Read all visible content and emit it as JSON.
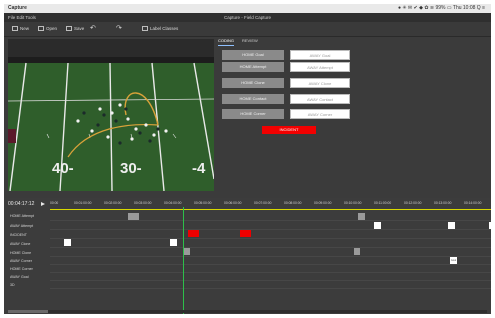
{
  "menubar": {
    "app": "Capture",
    "status": "● ✳ ✉ ✔ ◆ ✿ ≋ 99% ▭  Thu 10:08  Q  ≡"
  },
  "window": {
    "menu": "File  Edit  Tools",
    "title": "Capture - Field Capture"
  },
  "toolbar": {
    "new": "New",
    "open": "Open",
    "save": "Save",
    "label_classes": "Label Classes"
  },
  "video": {
    "yard_left": "40-",
    "yard_mid": "30-",
    "yard_right": "-4"
  },
  "tabs": [
    {
      "label": "CODING"
    },
    {
      "label": "REVIEW"
    }
  ],
  "coding": {
    "buttons": [
      "HOME Goal",
      "HOME Attempt",
      "HOME Clone",
      "HOME Contact",
      "HOME Corner"
    ],
    "inputs": [
      "AWAY Goal",
      "AWAY Attempt",
      "AWAY Clone",
      "AWAY Contact",
      "AWAY Corner"
    ],
    "incident": "INCIDENT"
  },
  "timeline": {
    "current_time": "00:04:17:12",
    "ticks": [
      "00:00",
      "00:01:00:00",
      "00:02:00:00",
      "00:03:00:00",
      "00:04:00:00",
      "00:05:00:00",
      "00:06:00:00",
      "00:07:00:00",
      "00:08:00:00",
      "00:09:00:00",
      "00:10:00:00",
      "00:11:00:00",
      "00:12:00:00",
      "00:13:00:00",
      "00:14:00:00"
    ],
    "rows": [
      "HOME Attempt",
      "AWAY Attempt",
      "INCIDENT",
      "AWAY Clone",
      "HOME Clone",
      "AWAY Corner",
      "HOME Corner",
      "AWAY Goal",
      "3D"
    ],
    "event_box": "Goal",
    "colors": {
      "incident": "#ef0000",
      "home": "#9a9a9a",
      "away": "#ffffff",
      "playhead": "#2dbf4a",
      "ruler": "#d9d900"
    }
  }
}
